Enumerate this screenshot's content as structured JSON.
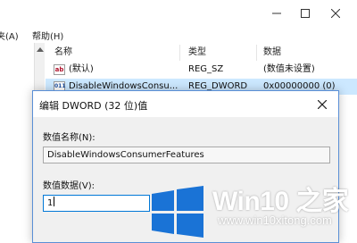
{
  "menubar": {
    "favorites_label": "夹(A)",
    "help_label": "帮助(H)"
  },
  "list": {
    "columns": {
      "name": "名称",
      "type": "类型",
      "data": "数据"
    },
    "rows": [
      {
        "icon": "string-value-icon",
        "icon_text": "ab",
        "name": "(默认)",
        "type": "REG_SZ",
        "data": "(数值未设置)"
      },
      {
        "icon": "binary-value-icon",
        "icon_text": "011",
        "name": "DisableWindowsConsu...",
        "type": "REG_DWORD",
        "data": "0x00000000 (0)"
      }
    ]
  },
  "dialog": {
    "title": "编辑 DWORD (32 位)值",
    "value_name_label": "数值名称(N):",
    "value_name": "DisableWindowsConsumerFeatures",
    "value_data_label": "数值数据(V):",
    "value_data": "1"
  },
  "watermark": {
    "brand": "Win10 之家",
    "url": "www.win10xitong.com"
  },
  "colors": {
    "selection": "#cce8ff",
    "windows_logo": "#1a73d6",
    "dialog_border": "#5a8fd6"
  }
}
